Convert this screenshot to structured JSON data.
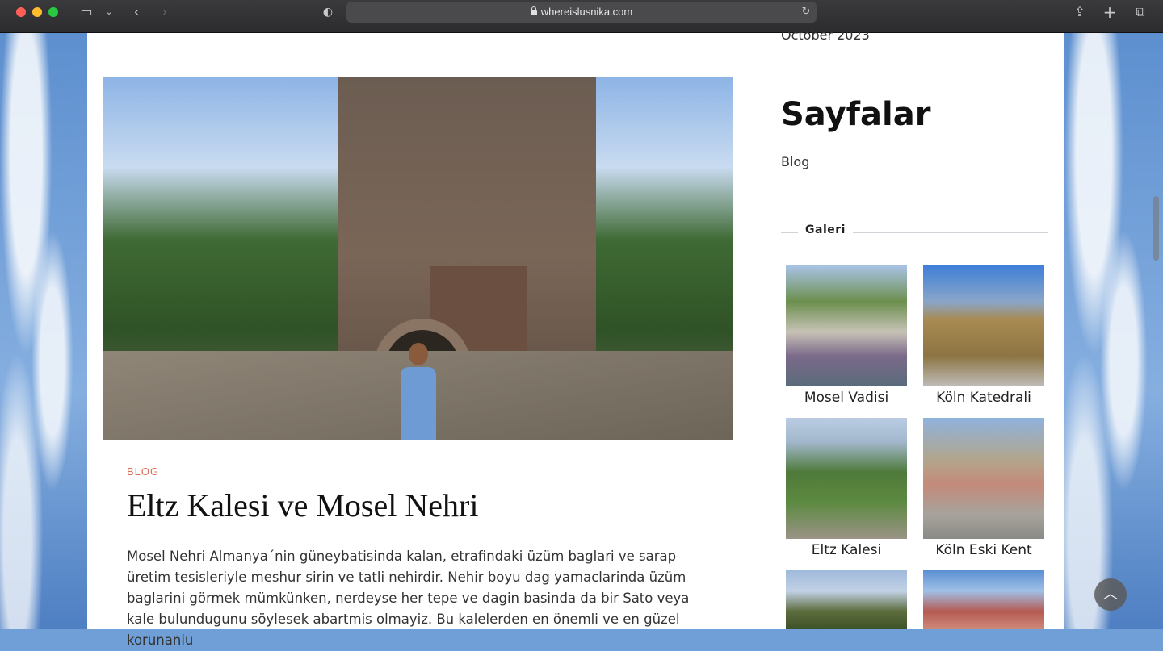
{
  "browser": {
    "url": "whereislusnika.com"
  },
  "article": {
    "category": "BLOG",
    "title": "Eltz Kalesi ve Mosel Nehri",
    "excerpt": "Mosel Nehri Almanya´nin güneybatisinda kalan, etrafindaki üzüm baglari ve sarap üretim tesisleriyle meshur sirin ve tatli nehirdir. Nehir boyu dag yamaclarinda üzüm baglarini görmek mümkünken, nerdeyse her tepe ve dagin basinda da bir Sato veya kale bulundugunu söylesek abartmis olmayiz. Bu kalelerden en önemli ve en güzel korunaniu"
  },
  "sidebar": {
    "archive_item": "October 2023",
    "pages_heading": "Sayfalar",
    "pages": [
      "Blog"
    ],
    "gallery_heading": "Galeri",
    "gallery": [
      {
        "caption": "Mosel Vadisi",
        "icon": "river-photo"
      },
      {
        "caption": "Köln Katedrali",
        "icon": "cathedral-photo"
      },
      {
        "caption": "Eltz Kalesi",
        "icon": "castle-photo"
      },
      {
        "caption": "Köln Eski Kent",
        "icon": "old-town-photo"
      },
      {
        "caption": "",
        "icon": "hill-castle-photo"
      },
      {
        "caption": "",
        "icon": "town-photo"
      }
    ]
  },
  "colors": {
    "category": "#d8705a",
    "accent": "#111111"
  }
}
